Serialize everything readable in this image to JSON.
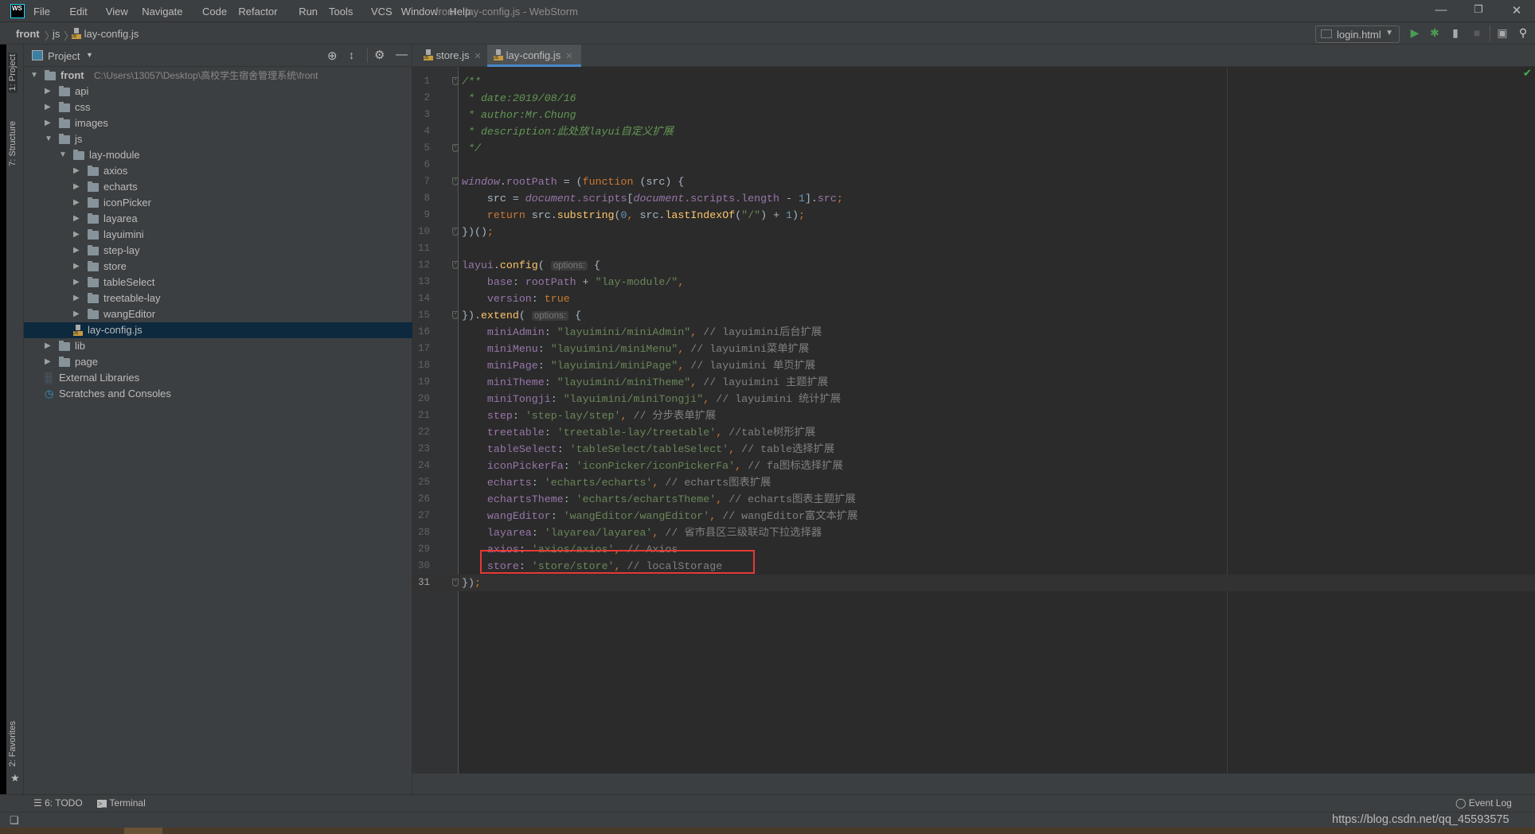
{
  "window": {
    "title": "front - lay-config.js - WebStorm",
    "logo": "WS",
    "controls": [
      "minimize-icon",
      "restore-icon",
      "close-icon"
    ]
  },
  "menu": [
    "File",
    "Edit",
    "View",
    "Navigate",
    "Code",
    "Refactor",
    "Run",
    "Tools",
    "VCS",
    "Window",
    "Help"
  ],
  "breadcrumb": [
    "front",
    "js",
    "lay-config.js"
  ],
  "run_config": "login.html",
  "side_tabs": {
    "project": "1: Project",
    "structure": "7: Structure",
    "favorites": "2: Favorites"
  },
  "project_panel": {
    "title": "Project",
    "tree": [
      {
        "label": "front",
        "path": "C:\\Users\\13057\\Desktop\\高校学生宿舍管理系统\\front",
        "depth": 0,
        "type": "folder",
        "expanded": true,
        "bold": true
      },
      {
        "label": "api",
        "depth": 1,
        "type": "folder",
        "expanded": false
      },
      {
        "label": "css",
        "depth": 1,
        "type": "folder",
        "expanded": false
      },
      {
        "label": "images",
        "depth": 1,
        "type": "folder",
        "expanded": false
      },
      {
        "label": "js",
        "depth": 1,
        "type": "folder",
        "expanded": true
      },
      {
        "label": "lay-module",
        "depth": 2,
        "type": "folder",
        "expanded": true
      },
      {
        "label": "axios",
        "depth": 3,
        "type": "folder",
        "expanded": false
      },
      {
        "label": "echarts",
        "depth": 3,
        "type": "folder",
        "expanded": false
      },
      {
        "label": "iconPicker",
        "depth": 3,
        "type": "folder",
        "expanded": false
      },
      {
        "label": "layarea",
        "depth": 3,
        "type": "folder",
        "expanded": false
      },
      {
        "label": "layuimini",
        "depth": 3,
        "type": "folder",
        "expanded": false
      },
      {
        "label": "step-lay",
        "depth": 3,
        "type": "folder",
        "expanded": false
      },
      {
        "label": "store",
        "depth": 3,
        "type": "folder",
        "expanded": false
      },
      {
        "label": "tableSelect",
        "depth": 3,
        "type": "folder",
        "expanded": false
      },
      {
        "label": "treetable-lay",
        "depth": 3,
        "type": "folder",
        "expanded": false
      },
      {
        "label": "wangEditor",
        "depth": 3,
        "type": "folder",
        "expanded": false
      },
      {
        "label": "lay-config.js",
        "depth": 2,
        "type": "js",
        "selected": true
      },
      {
        "label": "lib",
        "depth": 1,
        "type": "folder",
        "expanded": false
      },
      {
        "label": "page",
        "depth": 1,
        "type": "folder",
        "expanded": false
      },
      {
        "label": "External Libraries",
        "depth": 0,
        "type": "libs"
      },
      {
        "label": "Scratches and Consoles",
        "depth": 0,
        "type": "scratch"
      }
    ]
  },
  "tabs": [
    {
      "label": "store.js",
      "active": false
    },
    {
      "label": "lay-config.js",
      "active": true
    }
  ],
  "editor": {
    "current_line": 31,
    "highlighted_line": 30,
    "fold_lines": [
      1,
      5,
      7,
      10,
      12,
      15,
      31
    ],
    "lines": [
      [
        [
          "c",
          "/**"
        ]
      ],
      [
        [
          "c",
          " * date:2019/08/16"
        ]
      ],
      [
        [
          "c",
          " * author:Mr.Chung"
        ]
      ],
      [
        [
          "c",
          " * description:此处放layui自定义扩展"
        ]
      ],
      [
        [
          "c",
          " */"
        ]
      ],
      [],
      [
        [
          "pi",
          "window"
        ],
        [
          "d",
          "."
        ],
        [
          "p",
          "rootPath"
        ],
        [
          "d",
          " = ("
        ],
        [
          "k",
          "function"
        ],
        [
          "d",
          " (src) {"
        ]
      ],
      [
        [
          "d",
          "    src = "
        ],
        [
          "pi",
          "document"
        ],
        [
          "p",
          ".scripts"
        ],
        [
          "d",
          "["
        ],
        [
          "pi",
          "document"
        ],
        [
          "p",
          ".scripts.length"
        ],
        [
          "d",
          " - "
        ],
        [
          "n",
          "1"
        ],
        [
          "d",
          "]."
        ],
        [
          "p",
          "src"
        ],
        [
          "k",
          ";"
        ]
      ],
      [
        [
          "d",
          "    "
        ],
        [
          "k",
          "return"
        ],
        [
          "d",
          " src."
        ],
        [
          "f",
          "substring"
        ],
        [
          "d",
          "("
        ],
        [
          "n",
          "0"
        ],
        [
          "k",
          ", "
        ],
        [
          "d",
          "src."
        ],
        [
          "f",
          "lastIndexOf"
        ],
        [
          "d",
          "("
        ],
        [
          "s",
          "\"/\""
        ],
        [
          "d",
          ") + "
        ],
        [
          "n",
          "1"
        ],
        [
          "d",
          ")"
        ],
        [
          "k",
          ";"
        ]
      ],
      [
        [
          "d",
          "})()"
        ],
        [
          "k",
          ";"
        ]
      ],
      [],
      [
        [
          "p",
          "layui"
        ],
        [
          "d",
          "."
        ],
        [
          "f",
          "config"
        ],
        [
          "d",
          "( "
        ],
        [
          "h",
          "options:"
        ],
        [
          "d",
          " {"
        ]
      ],
      [
        [
          "d",
          "    "
        ],
        [
          "p",
          "base"
        ],
        [
          "d",
          ": "
        ],
        [
          "p",
          "rootPath"
        ],
        [
          "d",
          " + "
        ],
        [
          "s",
          "\"lay-module/\""
        ],
        [
          "k",
          ","
        ]
      ],
      [
        [
          "d",
          "    "
        ],
        [
          "p",
          "version"
        ],
        [
          "d",
          ": "
        ],
        [
          "k",
          "true"
        ]
      ],
      [
        [
          "d",
          "})."
        ],
        [
          "f",
          "extend"
        ],
        [
          "d",
          "( "
        ],
        [
          "h",
          "options:"
        ],
        [
          "d",
          " {"
        ]
      ],
      [
        [
          "d",
          "    "
        ],
        [
          "p",
          "miniAdmin"
        ],
        [
          "d",
          ": "
        ],
        [
          "s",
          "\"layuimini/miniAdmin\""
        ],
        [
          "k",
          ", "
        ],
        [
          "g",
          "// layuimini后台扩展"
        ]
      ],
      [
        [
          "d",
          "    "
        ],
        [
          "p",
          "miniMenu"
        ],
        [
          "d",
          ": "
        ],
        [
          "s",
          "\"layuimini/miniMenu\""
        ],
        [
          "k",
          ", "
        ],
        [
          "g",
          "// layuimini菜单扩展"
        ]
      ],
      [
        [
          "d",
          "    "
        ],
        [
          "p",
          "miniPage"
        ],
        [
          "d",
          ": "
        ],
        [
          "s",
          "\"layuimini/miniPage\""
        ],
        [
          "k",
          ", "
        ],
        [
          "g",
          "// layuimini 单页扩展"
        ]
      ],
      [
        [
          "d",
          "    "
        ],
        [
          "p",
          "miniTheme"
        ],
        [
          "d",
          ": "
        ],
        [
          "s",
          "\"layuimini/miniTheme\""
        ],
        [
          "k",
          ", "
        ],
        [
          "g",
          "// layuimini 主题扩展"
        ]
      ],
      [
        [
          "d",
          "    "
        ],
        [
          "p",
          "miniTongji"
        ],
        [
          "d",
          ": "
        ],
        [
          "s",
          "\"layuimini/miniTongji\""
        ],
        [
          "k",
          ", "
        ],
        [
          "g",
          "// layuimini 统计扩展"
        ]
      ],
      [
        [
          "d",
          "    "
        ],
        [
          "p",
          "step"
        ],
        [
          "d",
          ": "
        ],
        [
          "s",
          "'step-lay/step'"
        ],
        [
          "k",
          ", "
        ],
        [
          "g",
          "// 分步表单扩展"
        ]
      ],
      [
        [
          "d",
          "    "
        ],
        [
          "p",
          "treetable"
        ],
        [
          "d",
          ": "
        ],
        [
          "s",
          "'treetable-lay/treetable'"
        ],
        [
          "k",
          ", "
        ],
        [
          "g",
          "//table树形扩展"
        ]
      ],
      [
        [
          "d",
          "    "
        ],
        [
          "p",
          "tableSelect"
        ],
        [
          "d",
          ": "
        ],
        [
          "s",
          "'tableSelect/tableSelect'"
        ],
        [
          "k",
          ", "
        ],
        [
          "g",
          "// table选择扩展"
        ]
      ],
      [
        [
          "d",
          "    "
        ],
        [
          "p",
          "iconPickerFa"
        ],
        [
          "d",
          ": "
        ],
        [
          "s",
          "'iconPicker/iconPickerFa'"
        ],
        [
          "k",
          ", "
        ],
        [
          "g",
          "// fa图标选择扩展"
        ]
      ],
      [
        [
          "d",
          "    "
        ],
        [
          "p",
          "echarts"
        ],
        [
          "d",
          ": "
        ],
        [
          "s",
          "'echarts/echarts'"
        ],
        [
          "k",
          ", "
        ],
        [
          "g",
          "// echarts图表扩展"
        ]
      ],
      [
        [
          "d",
          "    "
        ],
        [
          "p",
          "echartsTheme"
        ],
        [
          "d",
          ": "
        ],
        [
          "s",
          "'echarts/echartsTheme'"
        ],
        [
          "k",
          ", "
        ],
        [
          "g",
          "// echarts图表主题扩展"
        ]
      ],
      [
        [
          "d",
          "    "
        ],
        [
          "p",
          "wangEditor"
        ],
        [
          "d",
          ": "
        ],
        [
          "s",
          "'wangEditor/wangEditor'"
        ],
        [
          "k",
          ", "
        ],
        [
          "g",
          "// wangEditor富文本扩展"
        ]
      ],
      [
        [
          "d",
          "    "
        ],
        [
          "p",
          "layarea"
        ],
        [
          "d",
          ": "
        ],
        [
          "s",
          "'layarea/layarea'"
        ],
        [
          "k",
          ", "
        ],
        [
          "g",
          "// 省市县区三级联动下拉选择器"
        ]
      ],
      [
        [
          "d",
          "    "
        ],
        [
          "p",
          "axios"
        ],
        [
          "d",
          ": "
        ],
        [
          "s",
          "'axios/axios'"
        ],
        [
          "k",
          ", "
        ],
        [
          "g",
          "// Axios"
        ]
      ],
      [
        [
          "d",
          "    "
        ],
        [
          "p",
          "store"
        ],
        [
          "d",
          ": "
        ],
        [
          "s",
          "'store/store'"
        ],
        [
          "k",
          ", "
        ],
        [
          "g",
          "// localStorage"
        ]
      ],
      [
        [
          "d",
          "})"
        ],
        [
          "k",
          ";"
        ]
      ]
    ]
  },
  "tool_windows": {
    "todo": "6: TODO",
    "terminal": "Terminal",
    "event_log": "Event Log"
  },
  "watermark": "https://blog.csdn.net/qq_45593575",
  "colors": {
    "accent": "#4a88c7",
    "highlight_box": "#e53935",
    "editor_bg": "#2b2b2b",
    "panel_bg": "#3c3f41"
  }
}
